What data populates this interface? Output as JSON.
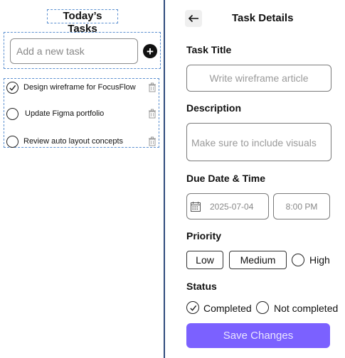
{
  "tasks_panel": {
    "title": "Today’s Tasks",
    "add_placeholder": "Add a new task",
    "add_button": "+",
    "tasks": [
      {
        "label": "Design wireframe for FocusFlow",
        "done": true
      },
      {
        "label": "Update Figma portfolio",
        "done": false
      },
      {
        "label": "Review auto layout concepts",
        "done": false
      }
    ]
  },
  "details": {
    "header": "Task Details",
    "back_icon": "arrow-left-icon",
    "title_label": "Task Title",
    "title_placeholder": "Write wireframe article",
    "description_label": "Description",
    "description_placeholder": "Make sure to include visuals",
    "due_label": "Due Date & Time",
    "due_date": "2025-07-04",
    "due_time": "8:00 PM",
    "priority_label": "Priority",
    "priority_options": [
      "Low",
      "Medium",
      "High"
    ],
    "status_label": "Status",
    "status_options": [
      "Completed",
      "Not completed"
    ],
    "status_selected": "Completed",
    "save_label": "Save Changes"
  },
  "colors": {
    "accent": "#7b61ff",
    "divider": "#2f4b7c",
    "selection_outline": "#5a8fd0"
  }
}
